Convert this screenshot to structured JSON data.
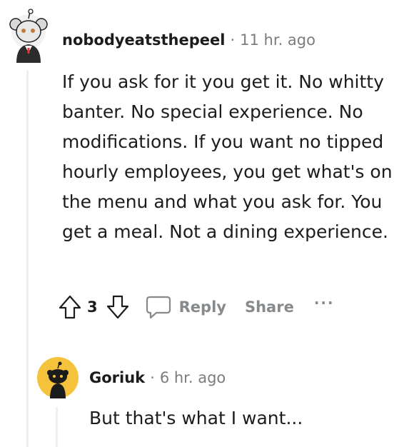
{
  "comment": {
    "username": "nobodyeatsthepeel",
    "separator": "·",
    "time": "11 hr. ago",
    "body": "If you ask for it you get it. No whitty banter. No special experience. No modifications. If you want no tipped hourly employees, you get what's on the menu and what you ask for. You get a meal. Not a dining experience.",
    "actions": {
      "upvote_icon": "upvote-arrow-icon",
      "vote_count": "3",
      "downvote_icon": "downvote-arrow-icon",
      "reply_icon": "speech-bubble-icon",
      "reply_label": "Reply",
      "share_label": "Share",
      "more_label": "···"
    }
  },
  "reply": {
    "username": "Goriuk",
    "separator": "·",
    "time": "6 hr. ago",
    "body": "But that's what I want..."
  },
  "colors": {
    "text": "#1c1c1c",
    "muted": "#7c7c7c",
    "action_gray": "#878a8c",
    "thread_line": "#edeff1",
    "reply_avatar_bg": "#f5c33b"
  }
}
